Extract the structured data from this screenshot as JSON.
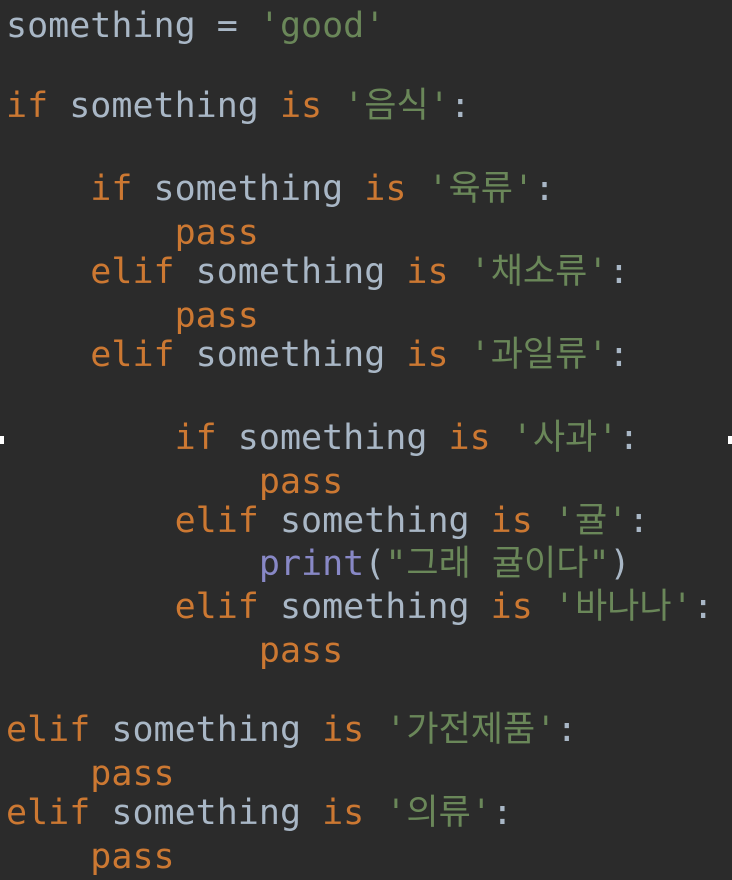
{
  "editor": {
    "lines": [
      {
        "tokens": [
          {
            "t": "something",
            "c": "id"
          },
          {
            "t": " = ",
            "c": "op"
          },
          {
            "t": "'good'",
            "c": "str"
          }
        ]
      },
      {
        "tokens": [
          {
            "t": "if",
            "c": "kw"
          },
          {
            "t": " something ",
            "c": "id"
          },
          {
            "t": "is",
            "c": "kw"
          },
          {
            "t": " ",
            "c": "op"
          },
          {
            "t": "'음식'",
            "c": "str"
          },
          {
            "t": ":",
            "c": "op"
          }
        ]
      },
      {
        "tokens": [
          {
            "t": "    ",
            "c": "op"
          },
          {
            "t": "if",
            "c": "kw"
          },
          {
            "t": " something ",
            "c": "id"
          },
          {
            "t": "is",
            "c": "kw"
          },
          {
            "t": " ",
            "c": "op"
          },
          {
            "t": "'육류'",
            "c": "str"
          },
          {
            "t": ":",
            "c": "op"
          }
        ]
      },
      {
        "tokens": [
          {
            "t": "        ",
            "c": "op"
          },
          {
            "t": "pass",
            "c": "kw"
          }
        ]
      },
      {
        "tokens": [
          {
            "t": "    ",
            "c": "op"
          },
          {
            "t": "elif",
            "c": "kw"
          },
          {
            "t": " something ",
            "c": "id"
          },
          {
            "t": "is",
            "c": "kw"
          },
          {
            "t": " ",
            "c": "op"
          },
          {
            "t": "'채소류'",
            "c": "str"
          },
          {
            "t": ":",
            "c": "op"
          }
        ]
      },
      {
        "tokens": [
          {
            "t": "        ",
            "c": "op"
          },
          {
            "t": "pass",
            "c": "kw"
          }
        ]
      },
      {
        "tokens": [
          {
            "t": "    ",
            "c": "op"
          },
          {
            "t": "elif",
            "c": "kw"
          },
          {
            "t": " something ",
            "c": "id"
          },
          {
            "t": "is",
            "c": "kw"
          },
          {
            "t": " ",
            "c": "op"
          },
          {
            "t": "'과일류'",
            "c": "str"
          },
          {
            "t": ":",
            "c": "op"
          }
        ]
      },
      {
        "tokens": [
          {
            "t": "        ",
            "c": "op"
          },
          {
            "t": "if",
            "c": "kw"
          },
          {
            "t": " something ",
            "c": "id"
          },
          {
            "t": "is",
            "c": "kw"
          },
          {
            "t": " ",
            "c": "op"
          },
          {
            "t": "'사과'",
            "c": "str"
          },
          {
            "t": ":",
            "c": "op"
          }
        ]
      },
      {
        "tokens": [
          {
            "t": "            ",
            "c": "op"
          },
          {
            "t": "pass",
            "c": "kw"
          }
        ]
      },
      {
        "tokens": [
          {
            "t": "        ",
            "c": "op"
          },
          {
            "t": "elif",
            "c": "kw"
          },
          {
            "t": " something ",
            "c": "id"
          },
          {
            "t": "is",
            "c": "kw"
          },
          {
            "t": " ",
            "c": "op"
          },
          {
            "t": "'귤'",
            "c": "str"
          },
          {
            "t": ":",
            "c": "op"
          }
        ]
      },
      {
        "tokens": [
          {
            "t": "            ",
            "c": "op"
          },
          {
            "t": "print",
            "c": "fn"
          },
          {
            "t": "(",
            "c": "op"
          },
          {
            "t": "\"그래 귤이다\"",
            "c": "str"
          },
          {
            "t": ")",
            "c": "op"
          }
        ]
      },
      {
        "tokens": [
          {
            "t": "        ",
            "c": "op"
          },
          {
            "t": "elif",
            "c": "kw"
          },
          {
            "t": " something ",
            "c": "id"
          },
          {
            "t": "is",
            "c": "kw"
          },
          {
            "t": " ",
            "c": "op"
          },
          {
            "t": "'바나나'",
            "c": "str"
          },
          {
            "t": ":",
            "c": "op"
          }
        ]
      },
      {
        "tokens": [
          {
            "t": "            ",
            "c": "op"
          },
          {
            "t": "pass",
            "c": "kw"
          }
        ]
      },
      {
        "tokens": [
          {
            "t": "elif",
            "c": "kw"
          },
          {
            "t": " something ",
            "c": "id"
          },
          {
            "t": "is",
            "c": "kw"
          },
          {
            "t": " ",
            "c": "op"
          },
          {
            "t": "'가전제품'",
            "c": "str"
          },
          {
            "t": ":",
            "c": "op"
          }
        ]
      },
      {
        "tokens": [
          {
            "t": "    ",
            "c": "op"
          },
          {
            "t": "pass",
            "c": "kw"
          }
        ]
      },
      {
        "tokens": [
          {
            "t": "elif",
            "c": "kw"
          },
          {
            "t": " something ",
            "c": "id"
          },
          {
            "t": "is",
            "c": "kw"
          },
          {
            "t": " ",
            "c": "op"
          },
          {
            "t": "'의류'",
            "c": "str"
          },
          {
            "t": ":",
            "c": "op"
          }
        ]
      },
      {
        "tokens": [
          {
            "t": "    ",
            "c": "op"
          },
          {
            "t": "pass",
            "c": "kw"
          }
        ]
      }
    ]
  }
}
